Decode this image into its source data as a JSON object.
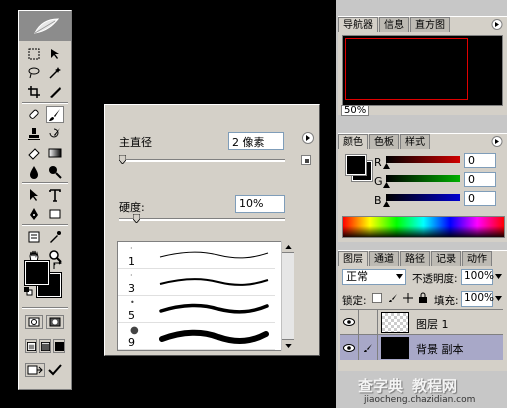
{
  "brush_popup": {
    "diameter_label": "主直径",
    "diameter_value": "2 像素",
    "hardness_label": "硬度:",
    "hardness_value": "10%",
    "hardness_level_percent": 10,
    "brushes": [
      {
        "size": "1"
      },
      {
        "size": "3"
      },
      {
        "size": "5"
      },
      {
        "size": "9"
      }
    ]
  },
  "navigator": {
    "tabs": [
      "导航器",
      "信息",
      "直方图"
    ],
    "zoom": "50%"
  },
  "color_panel": {
    "tabs": [
      "颜色",
      "色板",
      "样式"
    ],
    "channels": [
      {
        "label": "R",
        "value": "0",
        "color": "#d00000"
      },
      {
        "label": "G",
        "value": "0",
        "color": "#00b000"
      },
      {
        "label": "B",
        "value": "0",
        "color": "#0000d0"
      }
    ]
  },
  "layers_panel": {
    "tabs": [
      "图层",
      "通道",
      "路径",
      "记录",
      "动作"
    ],
    "blend_mode": "正常",
    "opacity_label": "不透明度:",
    "opacity_value": "100%",
    "lock_label": "锁定:",
    "fill_label": "填充:",
    "fill_value": "100%",
    "layers": [
      {
        "name": "图层 1"
      },
      {
        "name": "背景 副本"
      }
    ]
  },
  "watermark": {
    "line1": "查字典",
    "line2": "教程网",
    "url": "jiaocheng.chazidian.com"
  }
}
